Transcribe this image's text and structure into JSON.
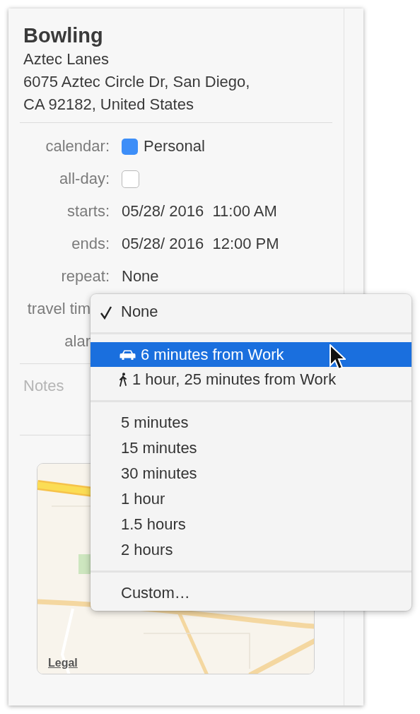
{
  "event": {
    "title": "Bowling",
    "location": "Aztec Lanes",
    "address": "6075 Aztec Circle Dr, San Diego, CA 92182, United States"
  },
  "fields": [
    {
      "kind": "color",
      "label": "calendar:",
      "value": "Personal",
      "color": "#3d8ef8"
    },
    {
      "kind": "checkbox",
      "label": "all-day:",
      "checked": false
    },
    {
      "kind": "text",
      "label": "starts:",
      "value": "05/28/ 2016  11:00 AM"
    },
    {
      "kind": "text",
      "label": "ends:",
      "value": "05/28/ 2016  12:00 PM"
    },
    {
      "kind": "text",
      "label": "repeat:",
      "value": "None"
    },
    {
      "kind": "covered",
      "label": "travel tim"
    },
    {
      "kind": "covered",
      "label": "alar"
    }
  ],
  "notes": {
    "placeholder": "Notes"
  },
  "map": {
    "kind": "picture",
    "legal_link": "Legal"
  },
  "menu": {
    "sections": [
      [
        {
          "kind": "plain",
          "label": "None",
          "checked": true,
          "selected": false
        }
      ],
      [
        {
          "kind": "car",
          "label": "6 minutes from Work",
          "checked": false,
          "selected": true
        },
        {
          "kind": "walk",
          "label": "1 hour, 25 minutes from Work",
          "checked": false,
          "selected": false
        }
      ],
      [
        {
          "kind": "plain",
          "label": "5 minutes",
          "checked": false,
          "selected": false
        },
        {
          "kind": "plain",
          "label": "15 minutes",
          "checked": false,
          "selected": false
        },
        {
          "kind": "plain",
          "label": "30 minutes",
          "checked": false,
          "selected": false
        },
        {
          "kind": "plain",
          "label": "1 hour",
          "checked": false,
          "selected": false
        },
        {
          "kind": "plain",
          "label": "1.5 hours",
          "checked": false,
          "selected": false
        },
        {
          "kind": "plain",
          "label": "2 hours",
          "checked": false,
          "selected": false
        }
      ],
      [
        {
          "kind": "plain",
          "label": "Custom…",
          "checked": false,
          "selected": false
        }
      ]
    ]
  }
}
